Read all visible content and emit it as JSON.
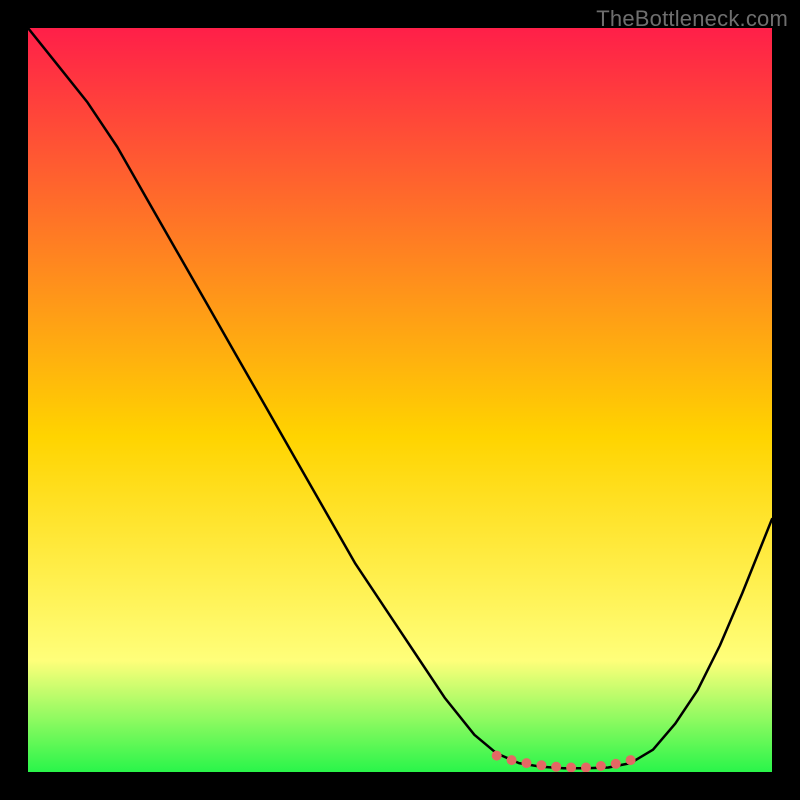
{
  "watermark": "TheBottleneck.com",
  "colors": {
    "black": "#000000",
    "grad_top": "#ff1f49",
    "grad_mid": "#ffd400",
    "grad_lowmid": "#ffff7a",
    "grad_bottom": "#29f54a",
    "curve": "#000000",
    "marker": "#e46864"
  },
  "chart_data": {
    "type": "line",
    "title": "",
    "xlabel": "",
    "ylabel": "",
    "xlim": [
      0,
      100
    ],
    "ylim": [
      0,
      100
    ],
    "series": [
      {
        "name": "curve",
        "x": [
          0,
          4,
          8,
          12,
          16,
          20,
          24,
          28,
          32,
          36,
          40,
          44,
          48,
          52,
          56,
          60,
          63,
          66,
          69,
          72,
          75,
          78,
          81,
          84,
          87,
          90,
          93,
          96,
          100
        ],
        "y": [
          100,
          95,
          90,
          84,
          77,
          70,
          63,
          56,
          49,
          42,
          35,
          28,
          22,
          16,
          10,
          5,
          2.5,
          1.2,
          0.7,
          0.5,
          0.5,
          0.6,
          1.2,
          3.0,
          6.5,
          11,
          17,
          24,
          34
        ]
      },
      {
        "name": "markers",
        "x": [
          63,
          65,
          67,
          69,
          71,
          73,
          75,
          77,
          79,
          81
        ],
        "y": [
          2.2,
          1.6,
          1.2,
          0.9,
          0.7,
          0.6,
          0.6,
          0.8,
          1.1,
          1.6
        ]
      }
    ],
    "annotations": []
  }
}
